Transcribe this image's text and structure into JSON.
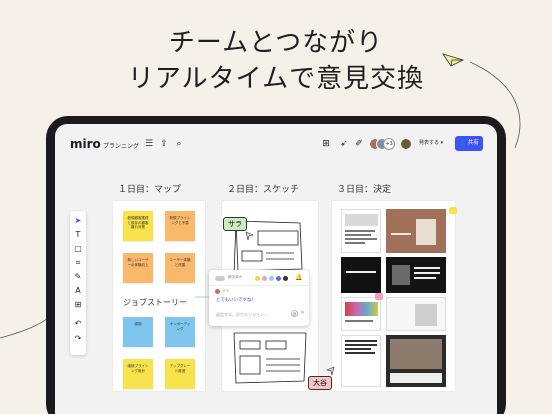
{
  "headline": {
    "line1": "チームとつながり",
    "line2": "リアルタイムで意見交換"
  },
  "app": {
    "logo": "miro",
    "board_name": "プランニング",
    "icons": {
      "menu": "menu-icon",
      "export": "export-icon",
      "search": "search-icon",
      "apps": "apps-icon",
      "cursor": "cursor-icon",
      "reactions": "confetti-icon"
    },
    "collaborator_count": "+3",
    "present_label": "発表する",
    "share_label": "共有",
    "accent": "#3d53f5"
  },
  "toolbar": {
    "tools": [
      {
        "icon": "select-icon",
        "glyph": "➤"
      },
      {
        "icon": "text-icon",
        "glyph": "T"
      },
      {
        "icon": "sticky-note-icon",
        "glyph": "▢"
      },
      {
        "icon": "frame-icon",
        "glyph": "⌗"
      },
      {
        "icon": "pen-icon",
        "glyph": "✎"
      },
      {
        "icon": "shape-icon",
        "glyph": "A"
      },
      {
        "icon": "add-icon",
        "glyph": "+"
      },
      {
        "icon": "undo-icon",
        "glyph": "↶"
      },
      {
        "icon": "redo-icon",
        "glyph": "↷"
      }
    ]
  },
  "columns": {
    "day1": "１日目：マップ",
    "day2": "２日目：スケッチ",
    "day3": "３日目：決定"
  },
  "stickies": [
    {
      "color": "yellow",
      "text": "新規顧客獲得と既存の顧客離れ対策"
    },
    {
      "color": "orange",
      "text": "新規プライシングと予算"
    },
    {
      "color": "orange",
      "text": "新しいユーザーの体験向上"
    },
    {
      "color": "orange",
      "text": "ユーザー体験と改善"
    },
    {
      "color": "blue",
      "text": "認知"
    },
    {
      "color": "blue",
      "text": "オンボーディング"
    },
    {
      "color": "yellow",
      "text": "継続プライシング設計"
    },
    {
      "color": "yellow",
      "text": "アップグレード推進"
    }
  ],
  "journey_label": "ジョブストーリー",
  "sticky_colors": {
    "yellow": "#f9e34c",
    "orange": "#fbb86a",
    "blue": "#7fc6ee"
  },
  "comment": {
    "toggle_label": "解決済み",
    "author": "サラ",
    "message": "とてもいいですね！",
    "input_placeholder": "返信する、＠でメンション...",
    "swatches": [
      "#f5d547",
      "#f29bc1",
      "#8fd1e8",
      "#6b6bd6",
      "#333333"
    ]
  },
  "cursors": {
    "sara": "サラ",
    "ootani": "大谷"
  }
}
